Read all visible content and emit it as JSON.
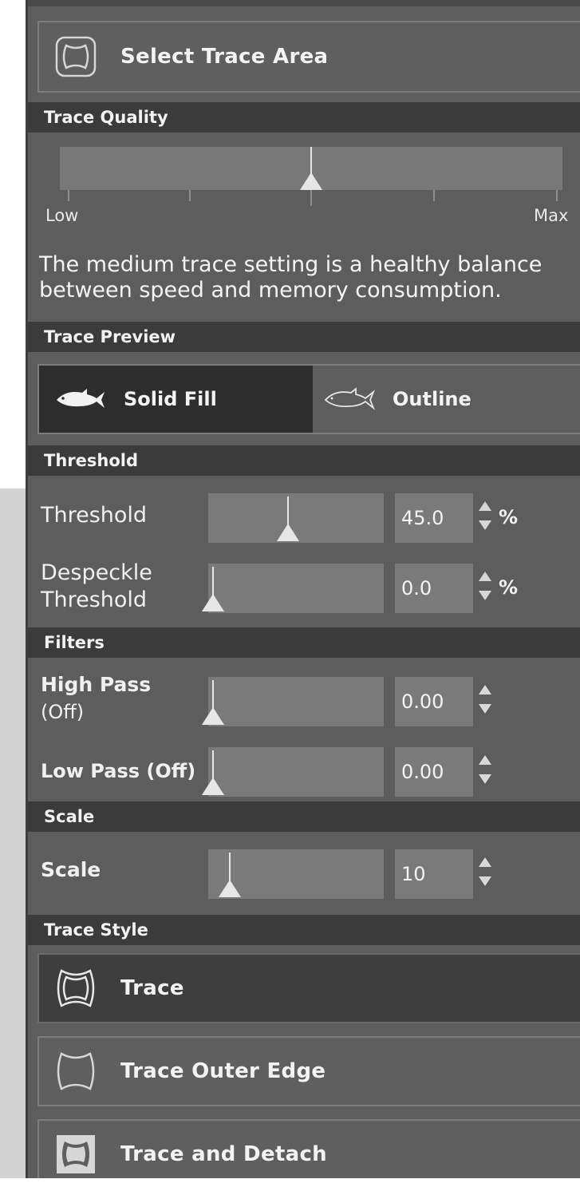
{
  "select_area": {
    "label": "Select Trace Area",
    "icon": "scalloped-frame-icon"
  },
  "trace_quality": {
    "header": "Trace Quality",
    "low_label": "Low",
    "max_label": "Max",
    "description": "The medium trace setting is a healthy balance between speed and memory consumption.",
    "level": 0.5
  },
  "trace_preview": {
    "header": "Trace Preview",
    "solid_fill_label": "Solid Fill",
    "outline_label": "Outline",
    "selected": "Solid Fill"
  },
  "threshold_section": {
    "header": "Threshold",
    "threshold": {
      "label": "Threshold",
      "value": "45.0",
      "unit": "%",
      "level": 0.45
    },
    "despeckle": {
      "label_line1": "Despeckle",
      "label_line2": "Threshold",
      "value": "0.0",
      "unit": "%",
      "level": 0.0
    }
  },
  "filters": {
    "header": "Filters",
    "high_pass": {
      "label_line1": "High Pass",
      "label_line2": "(Off)",
      "value": "0.00",
      "level": 0.0
    },
    "low_pass": {
      "label": "Low Pass (Off)",
      "value": "0.00",
      "level": 0.0
    }
  },
  "scale_section": {
    "header": "Scale",
    "scale": {
      "label": "Scale",
      "value": "10",
      "level": 0.1
    }
  },
  "trace_style": {
    "header": "Trace Style",
    "trace_label": "Trace",
    "outer_edge_label": "Trace Outer Edge",
    "detach_label": "Trace and Detach",
    "selected": "Trace"
  },
  "colors": {
    "panel_bg": "#5d5d5d",
    "section_header_bg": "#3b3b3b",
    "selected_bg": "#2d2d2d",
    "control_bg": "#7a7a7a"
  }
}
